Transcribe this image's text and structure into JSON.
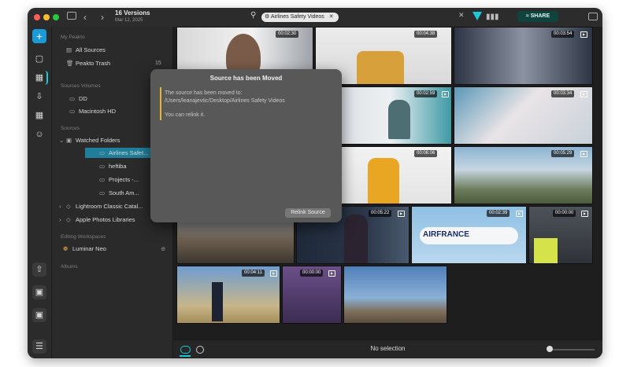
{
  "window": {
    "title": "16 Versions",
    "subtitle": "Mar 12, 2025"
  },
  "search": {
    "chip_label": "Airlines Safety Videos"
  },
  "toolbar": {
    "share_label": "SHARE",
    "accent_color": "#1ec8d8"
  },
  "sidebar": {
    "my_peakto": "My Peakto",
    "all_sources": "All Sources",
    "peakto_trash": "Peakto Trash",
    "trash_count": "15",
    "sources_volumes": "Sources Volumes",
    "volume_dd": "DD",
    "volume_mac": "Macintosh HD",
    "sources": "Sources",
    "watched_folders": "Watched Folders",
    "folder_airlines": "Airlines Safet...",
    "folder_heftiba": "heftiba",
    "folder_projects": "Projects -...",
    "folder_south": "South Am...",
    "lightroom": "Lightroom Classic Catal...",
    "apple_photos": "Apple Photos Libraries",
    "editing_workspaces": "Editing Workspaces",
    "luminar": "Luminar Neo",
    "albums": "Albums"
  },
  "tiles": [
    {
      "duration": "00:02:30"
    },
    {
      "duration": "00:04:38"
    },
    {
      "duration": "00:03:54"
    },
    {
      "duration": "00:02:59"
    },
    {
      "duration": "00:03:34"
    },
    {
      "duration": "00:06:06"
    },
    {
      "duration": "00:05:29"
    },
    {
      "duration": "00:05:22"
    },
    {
      "duration": "00:02:39"
    },
    {
      "duration": "00:00:00"
    },
    {
      "duration": "00:04:11"
    },
    {
      "duration": "00:00:00"
    },
    {
      "tag": "AIRFRANCE"
    }
  ],
  "dialog": {
    "title": "Source has been Moved",
    "line1": "The source has been moved to:",
    "path": "/Users/leanajevtic/Desktop/Airlines Safety Videos",
    "relink_text": "You can relink it.",
    "button": "Relink Source"
  },
  "status": {
    "selection": "No selection"
  }
}
